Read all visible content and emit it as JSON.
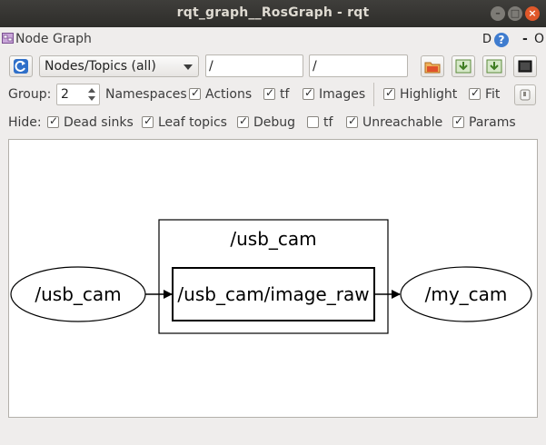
{
  "window": {
    "title": "rqt_graph__RosGraph - rqt"
  },
  "plugin": {
    "title": "Node Graph",
    "d_button": "D",
    "help_label": "?",
    "minimize_label": "-",
    "close_label": "O"
  },
  "toolbar": {
    "graph_mode": "Nodes/Topics (all)",
    "node_filter": "/",
    "topic_filter": "/"
  },
  "options": {
    "group_label": "Group:",
    "group_value": "2",
    "namespaces_label": "Namespaces",
    "namespaces": true,
    "actions_label": "Actions",
    "actions": true,
    "tf_label": "tf",
    "tf": true,
    "images_label": "Images",
    "images": true,
    "highlight_label": "Highlight",
    "highlight": true,
    "fit_label": "Fit",
    "fit": true
  },
  "hide": {
    "hide_label": "Hide:",
    "dead_sinks_label": "Dead sinks",
    "dead_sinks": true,
    "leaf_topics_label": "Leaf topics",
    "leaf_topics": true,
    "debug_label": "Debug",
    "debug": true,
    "tf_label": "tf",
    "tf": false,
    "unreachable_label": "Unreachable",
    "unreachable": true,
    "params_label": "Params",
    "params": true
  },
  "graph": {
    "namespace_box": "/usb_cam",
    "source_node": "/usb_cam",
    "topic": "/usb_cam/image_raw",
    "sink_node": "/my_cam"
  },
  "colors": {
    "titlebar": "#2e2d2a",
    "help_icon": "#3f7ccf",
    "refresh_icon": "#2f6fc9",
    "save_icon": "#e0522b",
    "export_icon": "#6aa84f"
  }
}
